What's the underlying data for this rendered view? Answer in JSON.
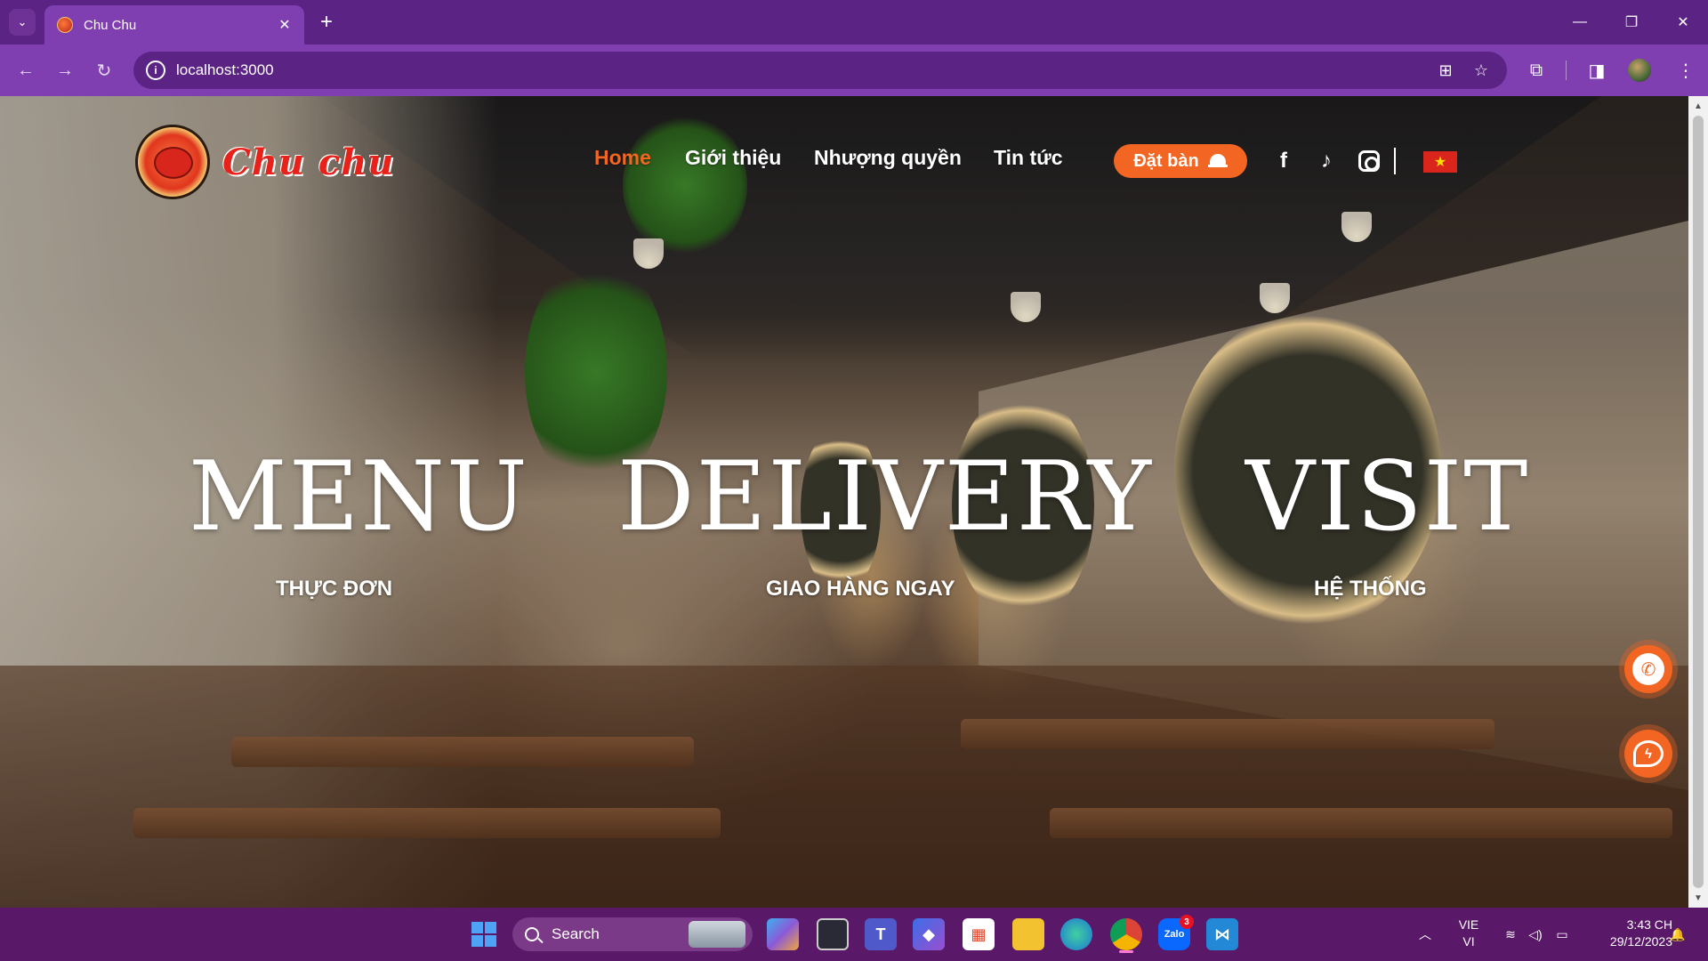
{
  "browser": {
    "tab": {
      "title": "Chu Chu"
    },
    "address": {
      "url": "localhost:3000"
    }
  },
  "site": {
    "logo_text": "Chu chu",
    "nav": [
      {
        "label": "Home",
        "active": true
      },
      {
        "label": "Giới thiệu",
        "active": false
      },
      {
        "label": "Nhượng quyền",
        "active": false
      },
      {
        "label": "Tin tức",
        "active": false
      }
    ],
    "book_button": "Đặt bàn",
    "social": [
      "facebook-icon",
      "tiktok-icon",
      "instagram-icon"
    ],
    "language_flag": "vietnam-flag-icon",
    "accent_color": "#f26522"
  },
  "hero": {
    "items": [
      {
        "title": "MENU",
        "subtitle": "THỰC ĐƠN"
      },
      {
        "title": "DELIVERY",
        "subtitle": "GIAO HÀNG NGAY"
      },
      {
        "title": "VISIT",
        "subtitle": "HỆ THỐNG"
      }
    ]
  },
  "floating": [
    "phone-icon",
    "messenger-icon"
  ],
  "taskbar": {
    "search_label": "Search",
    "zalo_badge": "3",
    "language": {
      "line1": "VIE",
      "line2": "VI"
    },
    "clock": {
      "time": "3:43 CH",
      "date": "29/12/2023"
    }
  }
}
